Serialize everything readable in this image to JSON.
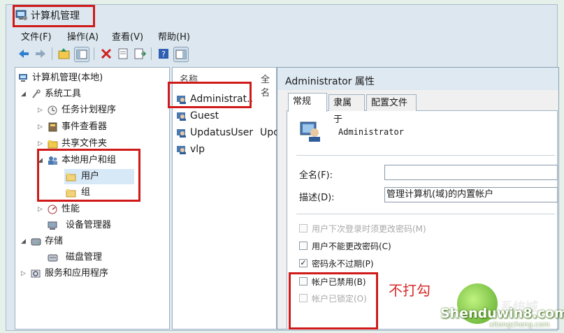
{
  "window": {
    "title": "计算机管理"
  },
  "menu": [
    "文件(F)",
    "操作(A)",
    "查看(V)",
    "帮助(H)"
  ],
  "tree": {
    "items": [
      {
        "label": "计算机管理(本地)"
      },
      {
        "label": "系统工具"
      },
      {
        "label": "任务计划程序"
      },
      {
        "label": "事件查看器"
      },
      {
        "label": "共享文件夹"
      },
      {
        "label": "本地用户和组"
      },
      {
        "label": "用户"
      },
      {
        "label": "组"
      },
      {
        "label": "性能"
      },
      {
        "label": "设备管理器"
      },
      {
        "label": "存储"
      },
      {
        "label": "磁盘管理"
      },
      {
        "label": "服务和应用程序"
      }
    ]
  },
  "list": {
    "headers": [
      "名称",
      "全名"
    ],
    "rows": [
      {
        "name": "Administrat..",
        "fullname": ""
      },
      {
        "name": "Guest",
        "fullname": ""
      },
      {
        "name": "UpdatusUser",
        "fullname": "Upc"
      },
      {
        "name": "vlp",
        "fullname": ""
      }
    ]
  },
  "dialog": {
    "title": "Administrator 属性",
    "tabs": [
      "常规",
      "隶属于",
      "配置文件"
    ],
    "user_name": "Administrator",
    "fullname_label": "全名(F):",
    "fullname_value": "",
    "desc_label": "描述(D):",
    "desc_value": "管理计算机(域)的内置帐户",
    "checkboxes": [
      {
        "label": "用户下次登录时须更改密码(M)",
        "checked": false,
        "disabled": true
      },
      {
        "label": "用户不能更改密码(C)",
        "checked": false,
        "disabled": false
      },
      {
        "label": "密码永不过期(P)",
        "checked": true,
        "disabled": false
      },
      {
        "label": "帐户已禁用(B)",
        "checked": false,
        "disabled": false
      },
      {
        "label": "帐户已锁定(O)",
        "checked": false,
        "disabled": true
      }
    ]
  },
  "annotation": {
    "note": "不打勾"
  },
  "watermark": {
    "site": "Shenduwin8.com",
    "sub": "xitongcheng.com",
    "brand": "系统城"
  },
  "colors": {
    "highlight": "#d01a1a",
    "note": "#d82a2a"
  }
}
